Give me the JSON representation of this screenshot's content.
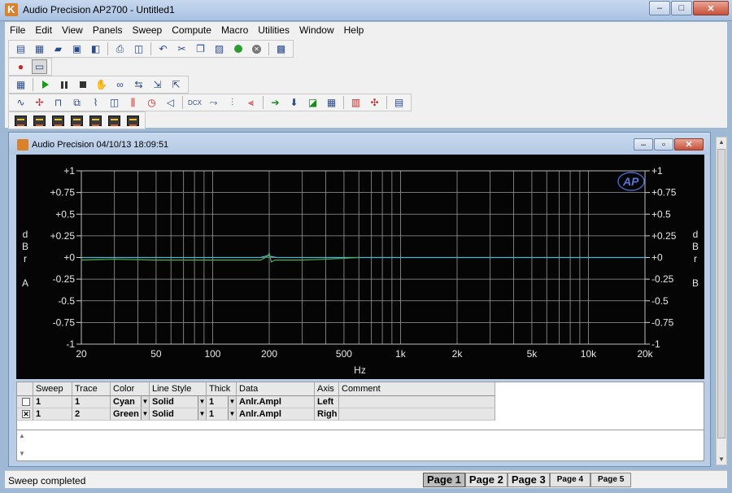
{
  "window": {
    "title": "Audio Precision AP2700 - Untitled1",
    "minimize": "–",
    "maximize": "□",
    "close": "✕"
  },
  "menu": [
    "File",
    "Edit",
    "View",
    "Panels",
    "Sweep",
    "Compute",
    "Macro",
    "Utilities",
    "Window",
    "Help"
  ],
  "child": {
    "title": "Audio Precision  04/10/13 18:09:51",
    "minimize": "–",
    "restore": "▫",
    "close": "✕"
  },
  "graph": {
    "logo": "AP",
    "ylabel_left": "dBrA",
    "ylabel_right": "dBrB",
    "xlabel": "Hz"
  },
  "chart_data": {
    "type": "line",
    "xscale": "log",
    "xlim": [
      20,
      20000
    ],
    "ylim": [
      -1,
      1
    ],
    "x_ticks": [
      20,
      50,
      100,
      200,
      500,
      1000,
      2000,
      5000,
      10000,
      20000
    ],
    "x_tick_labels": [
      "20",
      "50",
      "100",
      "200",
      "500",
      "1k",
      "2k",
      "5k",
      "10k",
      "20k"
    ],
    "y_ticks": [
      1,
      0.75,
      0.5,
      0.25,
      0,
      -0.25,
      -0.5,
      -0.75,
      -1
    ],
    "y_tick_labels": [
      "+1",
      "+0.75",
      "+0.5",
      "+0.25",
      "+0",
      "-0.25",
      "-0.5",
      "-0.75",
      "-1"
    ],
    "grid": true,
    "series": [
      {
        "color": "#49b6d6",
        "x": [
          20,
          30,
          100,
          180,
          195,
          200,
          205,
          220,
          300,
          1000,
          5000,
          20000
        ],
        "y": [
          0,
          0,
          0,
          0,
          0.02,
          0.02,
          0.01,
          0,
          0,
          0,
          0,
          0
        ]
      },
      {
        "color": "#4fa04f",
        "x": [
          20,
          30,
          50,
          100,
          180,
          195,
          200,
          205,
          215,
          300,
          400,
          600
        ],
        "y": [
          -0.03,
          -0.02,
          -0.03,
          -0.03,
          -0.03,
          0.01,
          0.05,
          -0.05,
          -0.03,
          -0.03,
          -0.02,
          0
        ]
      }
    ]
  },
  "trace_table": {
    "headers": [
      "",
      "Sweep",
      "Trace",
      "Color",
      "Line Style",
      "Thick",
      "Data",
      "Axis",
      "Comment"
    ],
    "rows": [
      {
        "checked": "",
        "sweep": "1",
        "trace": "1",
        "color": "Cyan",
        "style": "Solid",
        "thick": "1",
        "data": "Anlr.Ampl",
        "axis": "Left"
      },
      {
        "checked": "✕",
        "sweep": "1",
        "trace": "2",
        "color": "Green",
        "style": "Solid",
        "thick": "1",
        "data": "Anlr.Ampl",
        "axis": "Righ"
      }
    ]
  },
  "status": {
    "text": "Sweep completed"
  },
  "pages": [
    "Page 1",
    "Page 2",
    "Page 3",
    "Page 4",
    "Page 5"
  ]
}
